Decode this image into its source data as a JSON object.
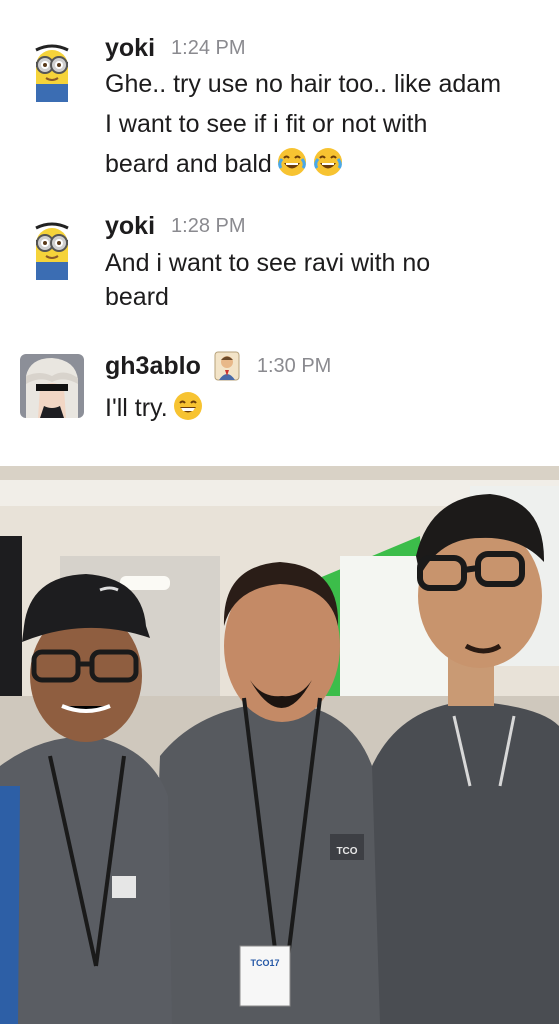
{
  "messages": [
    {
      "user": "yoki",
      "time": "1:24 PM",
      "lines": [
        "Ghe.. try use no hair too.. like adam",
        "I want to see if i fit or not with",
        "beard and bald"
      ],
      "emoji": [
        "joy-face-icon",
        "joy-face-icon"
      ]
    },
    {
      "user": "yoki",
      "time": "1:28 PM",
      "lines": [
        "And i want to see ravi with no",
        "beard"
      ]
    },
    {
      "user": "gh3ablo",
      "time": "1:30 PM",
      "lines": [
        "I'll try."
      ],
      "emoji": [
        "grin-face-icon"
      ],
      "badge": "person-badge-icon"
    }
  ],
  "photo": {
    "lanyard_text": "TCO17",
    "hoodie_logo_text": "TCO"
  },
  "colors": {
    "name": "#1d1c1d",
    "timestamp": "#8a8a8f",
    "background": "#ffffff"
  }
}
